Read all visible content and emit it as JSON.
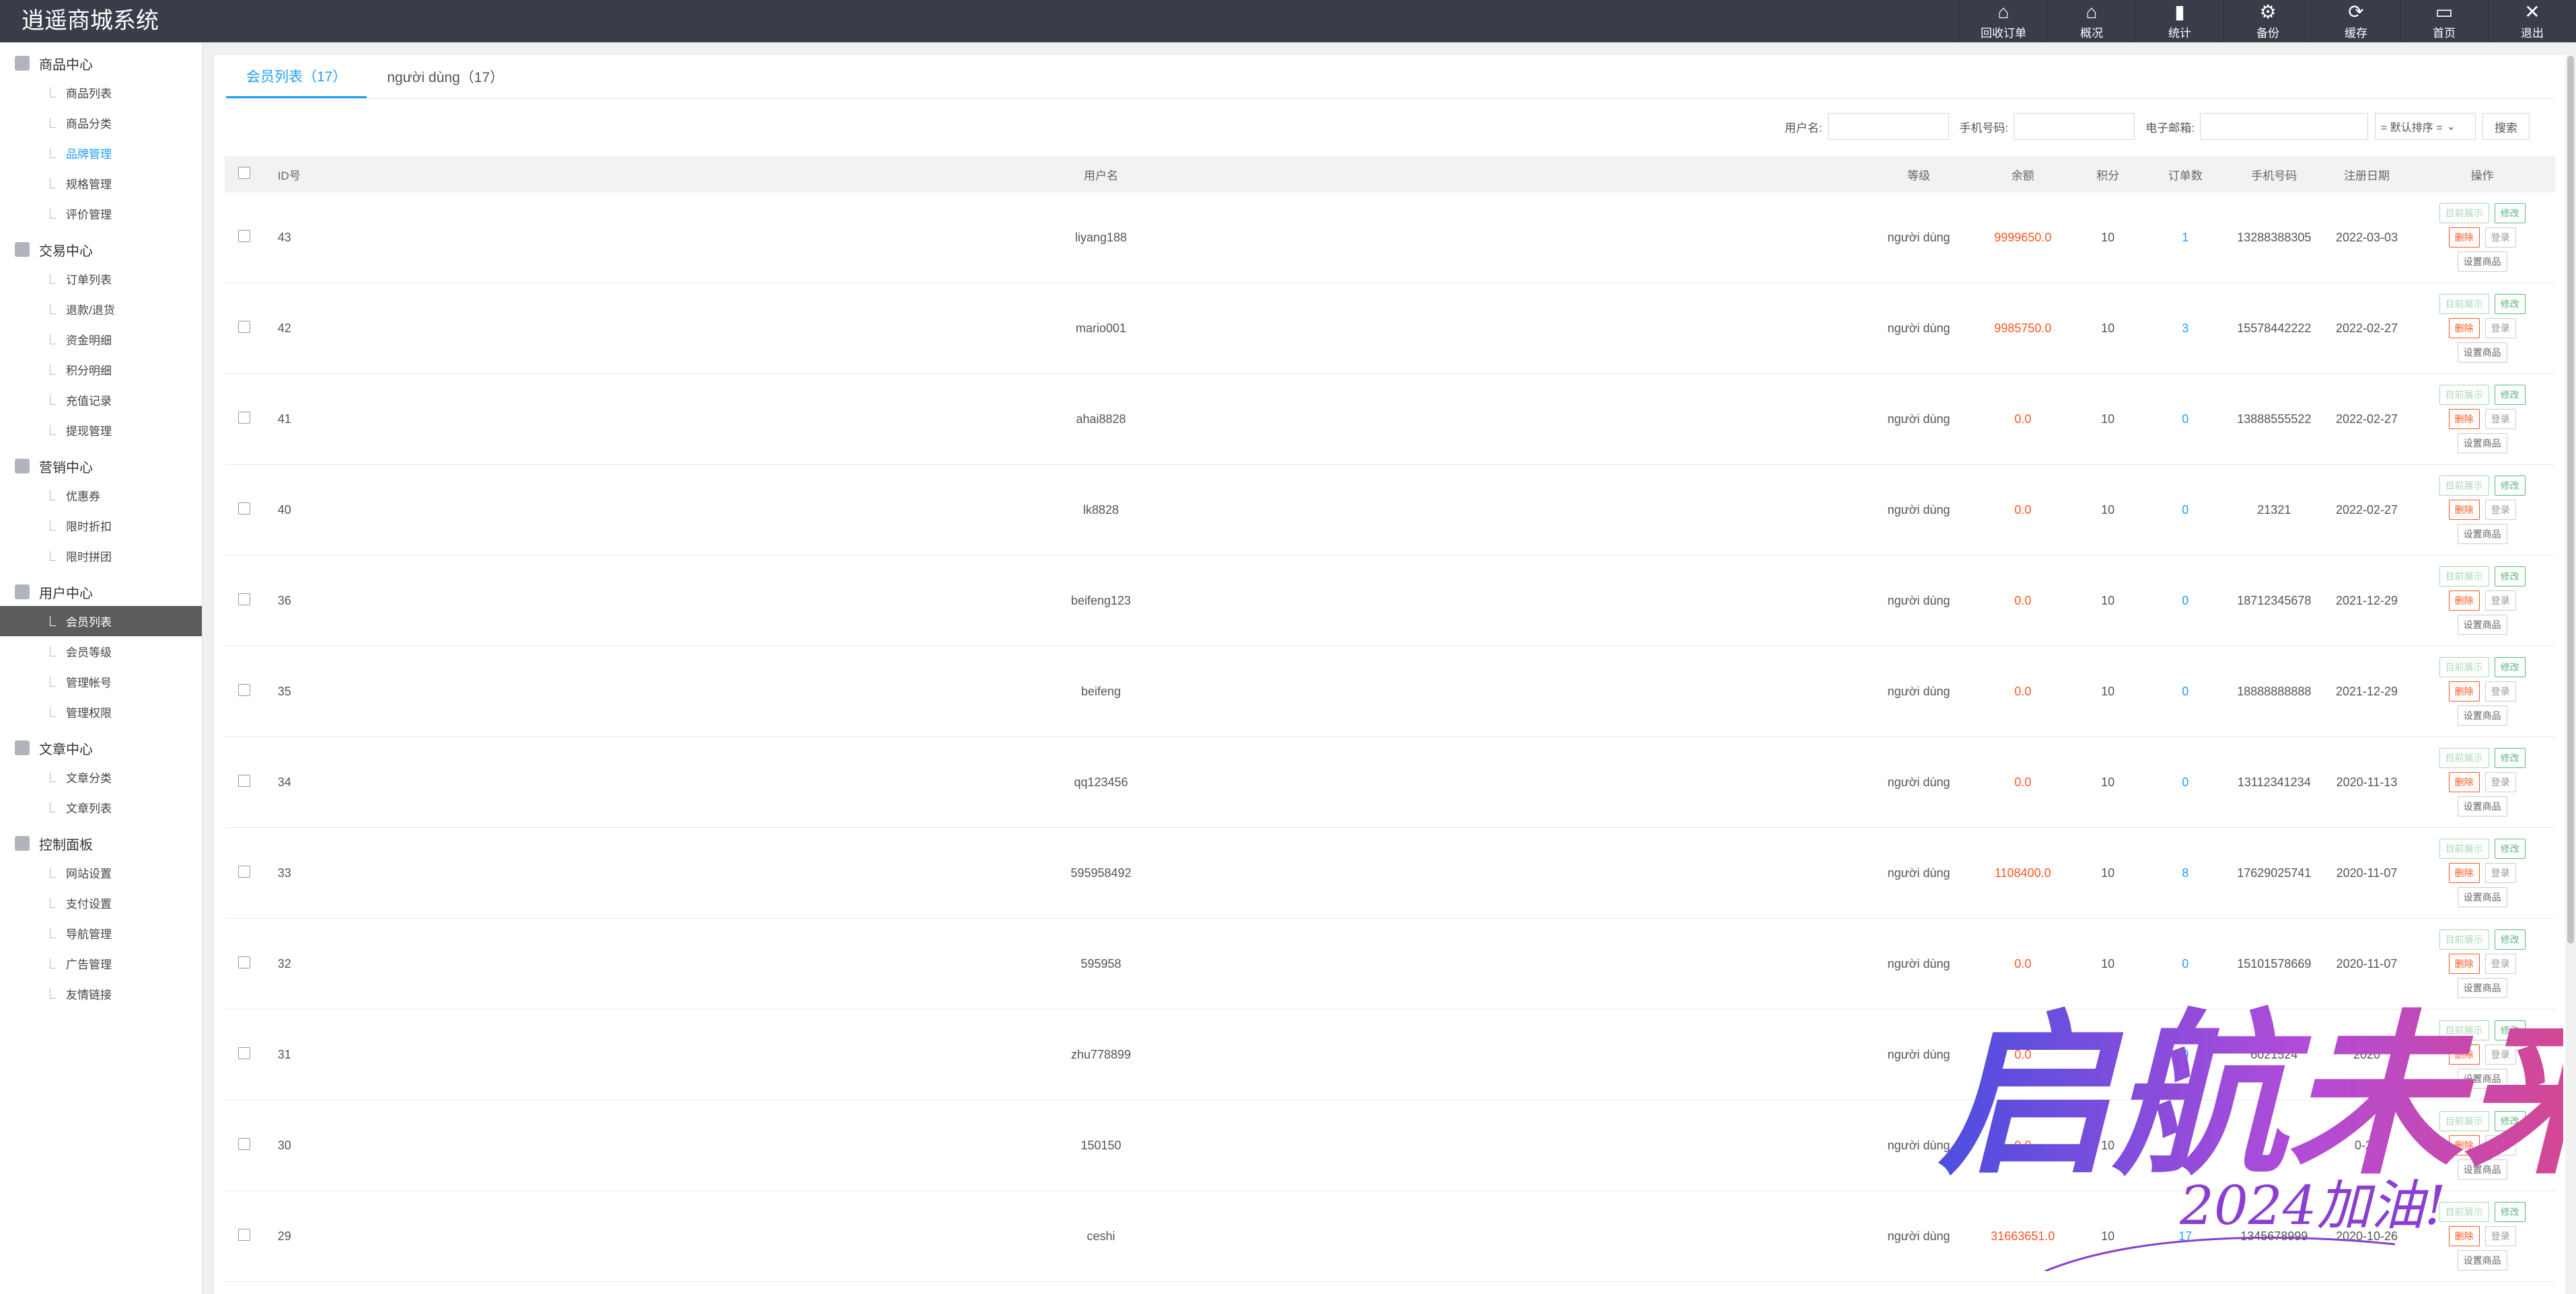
{
  "app": {
    "title": "逍遥商城系统"
  },
  "topnav": [
    {
      "label": "回收订单",
      "icon": "home-icon"
    },
    {
      "label": "概况",
      "icon": "home-icon"
    },
    {
      "label": "统计",
      "icon": "bar-chart-icon"
    },
    {
      "label": "备份",
      "icon": "gear-icon"
    },
    {
      "label": "缓存",
      "icon": "refresh-icon"
    },
    {
      "label": "首页",
      "icon": "monitor-icon"
    },
    {
      "label": "退出",
      "icon": "close-icon"
    }
  ],
  "sidebar": {
    "groups": [
      {
        "title": "商品中心",
        "items": [
          "商品列表",
          "商品分类",
          "品牌管理",
          "规格管理",
          "评价管理"
        ]
      },
      {
        "title": "交易中心",
        "items": [
          "订单列表",
          "退款/退货",
          "资金明细",
          "积分明细",
          "充值记录",
          "提现管理"
        ]
      },
      {
        "title": "营销中心",
        "items": [
          "优惠券",
          "限时折扣",
          "限时拼团"
        ]
      },
      {
        "title": "用户中心",
        "items": [
          "会员列表",
          "会员等级",
          "管理帐号",
          "管理权限"
        ]
      },
      {
        "title": "文章中心",
        "items": [
          "文章分类",
          "文章列表"
        ]
      },
      {
        "title": "控制面板",
        "items": [
          "网站设置",
          "支付设置",
          "导航管理",
          "广告管理",
          "友情链接"
        ]
      }
    ]
  },
  "tabs": [
    "会员列表（17）",
    "người dùng（17）"
  ],
  "filters": {
    "username_label": "用户名:",
    "phone_label": "手机号码:",
    "email_label": "电子邮箱:",
    "sort_value": "= 默认排序 =",
    "search_label": "搜索"
  },
  "table": {
    "headers": [
      "ID号",
      "用户名",
      "等级",
      "余额",
      "积分",
      "订单数",
      "手机号码",
      "注册日期",
      "操作"
    ],
    "rows": [
      {
        "id": "43",
        "username": "liyang188",
        "level": "người dùng",
        "balance": "9999650.0",
        "points": "10",
        "orders": "1",
        "phone": "13288388305",
        "date": "2022-03-03"
      },
      {
        "id": "42",
        "username": "mario001",
        "level": "người dùng",
        "balance": "9985750.0",
        "points": "10",
        "orders": "3",
        "phone": "15578442222",
        "date": "2022-02-27"
      },
      {
        "id": "41",
        "username": "ahai8828",
        "level": "người dùng",
        "balance": "0.0",
        "points": "10",
        "orders": "0",
        "phone": "13888555522",
        "date": "2022-02-27"
      },
      {
        "id": "40",
        "username": "lk8828",
        "level": "người dùng",
        "balance": "0.0",
        "points": "10",
        "orders": "0",
        "phone": "21321",
        "date": "2022-02-27"
      },
      {
        "id": "36",
        "username": "beifeng123",
        "level": "người dùng",
        "balance": "0.0",
        "points": "10",
        "orders": "0",
        "phone": "18712345678",
        "date": "2021-12-29"
      },
      {
        "id": "35",
        "username": "beifeng",
        "level": "người dùng",
        "balance": "0.0",
        "points": "10",
        "orders": "0",
        "phone": "18888888888",
        "date": "2021-12-29"
      },
      {
        "id": "34",
        "username": "qq123456",
        "level": "người dùng",
        "balance": "0.0",
        "points": "10",
        "orders": "0",
        "phone": "13112341234",
        "date": "2020-11-13"
      },
      {
        "id": "33",
        "username": "595958492",
        "level": "người dùng",
        "balance": "1108400.0",
        "points": "10",
        "orders": "8",
        "phone": "17629025741",
        "date": "2020-11-07"
      },
      {
        "id": "32",
        "username": "595958",
        "level": "người dùng",
        "balance": "0.0",
        "points": "10",
        "orders": "0",
        "phone": "15101578669",
        "date": "2020-11-07"
      },
      {
        "id": "31",
        "username": "zhu778899",
        "level": "người dùng",
        "balance": "0.0",
        "points": "10",
        "orders": "0",
        "phone": "6021524",
        "date": "2020"
      },
      {
        "id": "30",
        "username": "150150",
        "level": "người dùng",
        "balance": "0.0",
        "points": "10",
        "orders": "0",
        "phone": "",
        "date": "0-27"
      },
      {
        "id": "29",
        "username": "ceshi",
        "level": "người dùng",
        "balance": "31663651.0",
        "points": "10",
        "orders": "17",
        "phone": "1345678999",
        "date": "2020-10-26"
      }
    ],
    "actions": {
      "display": "目前展示",
      "edit": "修改",
      "delete": "删除",
      "login": "登录",
      "set_goods": "设置商品"
    }
  },
  "watermark": {
    "main": "启航未来",
    "sub": "2024加油!"
  }
}
